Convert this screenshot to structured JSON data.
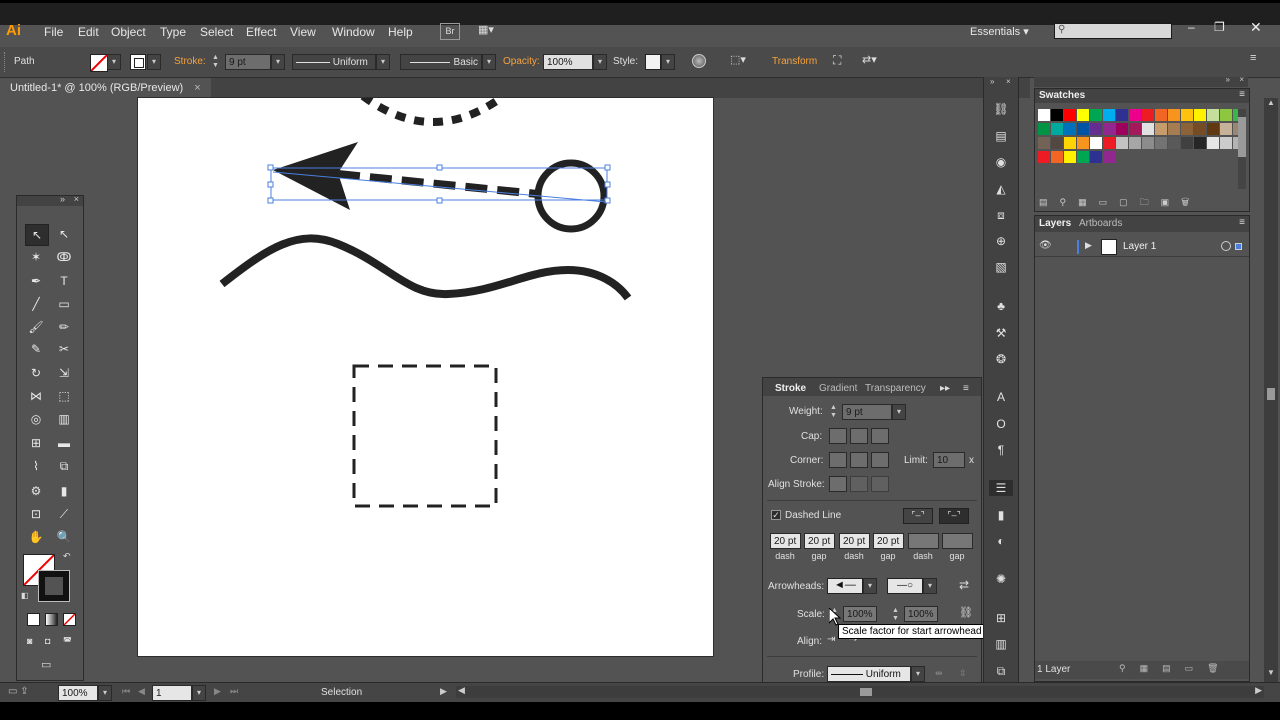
{
  "app": {
    "logo": "Ai",
    "menus": [
      "File",
      "Edit",
      "Object",
      "Type",
      "Select",
      "Effect",
      "View",
      "Window",
      "Help"
    ],
    "br_label": "Br",
    "workspace": "Essentials",
    "search_placeholder": ""
  },
  "control_bar": {
    "selection_type": "Path",
    "stroke_label": "Stroke:",
    "stroke_weight": "9 pt",
    "profile": "Uniform",
    "brush": "Basic",
    "opacity_label": "Opacity:",
    "opacity_value": "100%",
    "style_label": "Style:",
    "transform_label": "Transform"
  },
  "document": {
    "tab_title": "Untitled-1* @ 100% (RGB/Preview)"
  },
  "stroke_panel": {
    "tabs": [
      "Stroke",
      "Gradient",
      "Transparency"
    ],
    "weight_label": "Weight:",
    "weight_value": "9 pt",
    "cap_label": "Cap:",
    "corner_label": "Corner:",
    "limit_label": "Limit:",
    "limit_value": "10",
    "limit_unit": "x",
    "align_stroke_label": "Align Stroke:",
    "dashed_line_label": "Dashed Line",
    "dashed_line_checked": true,
    "dash_values": [
      "20 pt",
      "20 pt",
      "20 pt",
      "20 pt",
      "",
      ""
    ],
    "dash_labels": [
      "dash",
      "gap",
      "dash",
      "gap",
      "dash",
      "gap"
    ],
    "arrowheads_label": "Arrowheads:",
    "scale_label": "Scale:",
    "scale_start": "100%",
    "scale_end": "100%",
    "align_label": "Align:",
    "profile_label": "Profile:",
    "profile_value": "Uniform"
  },
  "tooltip": {
    "text": "Scale factor for start arrowhead"
  },
  "swatches_panel": {
    "title": "Swatches",
    "colors": [
      "#ffffff",
      "#000000",
      "#ff0000",
      "#ffff00",
      "#00a651",
      "#00aeef",
      "#2e3192",
      "#ec008c",
      "#ed1c24",
      "#f26522",
      "#f7941d",
      "#ffc20e",
      "#fff200",
      "#c4df9b",
      "#8dc63f",
      "#39b54a",
      "#009444",
      "#00a99d",
      "#0072bc",
      "#0054a6",
      "#662d91",
      "#92278f",
      "#9e005d",
      "#a3195b",
      "#e1e1e1",
      "#c69c6d",
      "#a67c52",
      "#8c6239",
      "#754c24",
      "#603913",
      "#c7b299",
      "#998675",
      "#736357",
      "#534741",
      "#ffd400",
      "#f7941d",
      "#ffffff",
      "#ed1c24",
      "#c2c2c2",
      "#a6a6a6",
      "#8c8c8c",
      "#737373",
      "#595959",
      "#404040",
      "#262626",
      "#e6e6e6",
      "#cccccc",
      "#b3b3b3",
      "#ed1c24",
      "#f26522",
      "#fff200",
      "#00a651",
      "#2e3192",
      "#92278f"
    ]
  },
  "layers_panel": {
    "tabs": [
      "Layers",
      "Artboards"
    ],
    "layer_name": "Layer 1",
    "footer_count": "1 Layer"
  },
  "status_bar": {
    "zoom": "100%",
    "artboard": "1",
    "tool": "Selection"
  },
  "colors": {
    "accent_orange": "#f7a33c",
    "selection_blue": "#4a7fe0"
  }
}
